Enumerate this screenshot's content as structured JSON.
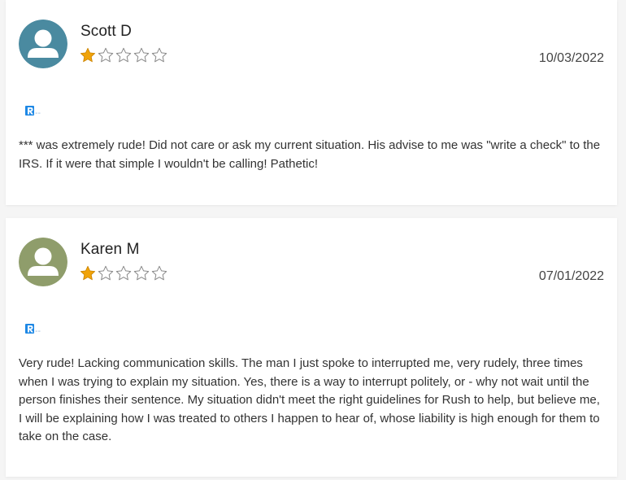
{
  "reviews": [
    {
      "reviewer_name": "Scott D",
      "rating": 1,
      "max_rating": 5,
      "date": "10/03/2022",
      "avatar_color": "#4a8aa0",
      "source_icon": "source-logo-icon",
      "text": "*** was extremely rude! Did not care or ask my current situation. His advise to me was \"write a check\" to the IRS. If it were that simple I wouldn't be calling! Pathetic!"
    },
    {
      "reviewer_name": "Karen M",
      "rating": 1,
      "max_rating": 5,
      "date": "07/01/2022",
      "avatar_color": "#8f9d6b",
      "source_icon": "source-logo-icon",
      "text": "Very rude! Lacking communication skills. The man I just spoke to interrupted me, very rudely, three times when I was trying to explain my situation. Yes, there is a way to interrupt politely, or - why not wait until the person finishes their sentence. My situation didn't meet the right guidelines for Rush to help, but believe me, I will be explaining how I was treated to others I happen to hear of, whose liability is high enough for them to take on the case."
    }
  ],
  "colors": {
    "star_filled": "#f0a30a",
    "star_empty_stroke": "#888888",
    "page_background": "#f5f5f5",
    "card_background": "#ffffff",
    "source_icon_blue": "#1e88e5"
  }
}
